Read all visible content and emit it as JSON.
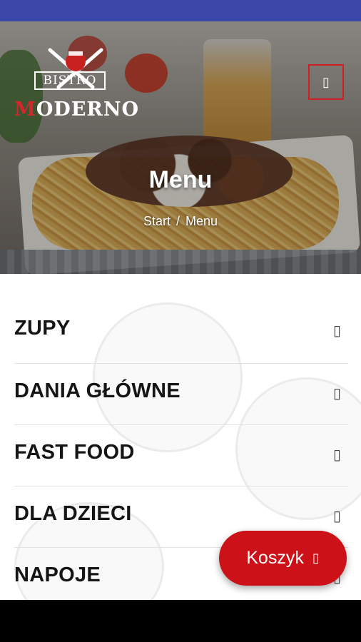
{
  "header": {
    "logo": {
      "top_text": "BISTRO",
      "name_first": "M",
      "name_rest": "ODERNO"
    },
    "menu_icon_glyph": "▯"
  },
  "hero": {
    "title": "Menu",
    "breadcrumb": {
      "home": "Start",
      "separator": "/",
      "current": "Menu"
    }
  },
  "categories": [
    {
      "label": "ZUPY",
      "icon": "chevron-right-icon",
      "glyph": "▯"
    },
    {
      "label": "DANIA GŁÓWNE",
      "icon": "chevron-right-icon",
      "glyph": "▯"
    },
    {
      "label": "FAST FOOD",
      "icon": "chevron-right-icon",
      "glyph": "▯"
    },
    {
      "label": "DLA DZIECI",
      "icon": "chevron-right-icon",
      "glyph": "▯"
    },
    {
      "label": "NAPOJE",
      "icon": "chevron-right-icon",
      "glyph": "▯"
    }
  ],
  "cart": {
    "label": "Koszyk",
    "icon": "cart-icon",
    "glyph": "▯"
  },
  "colors": {
    "status_bar": "#3a46a8",
    "accent": "#cc1218",
    "menu_border": "#d21f25"
  }
}
